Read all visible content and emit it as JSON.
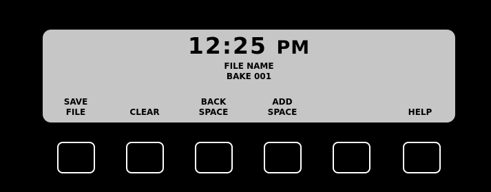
{
  "display": {
    "time": "12:25",
    "ampm": "PM",
    "file_label": "FILE NAME",
    "file_value": "BAKE 001"
  },
  "softkeys": [
    {
      "line1": "SAVE",
      "line2": "FILE"
    },
    {
      "line1": "",
      "line2": "CLEAR"
    },
    {
      "line1": "BACK",
      "line2": "SPACE"
    },
    {
      "line1": "ADD",
      "line2": "SPACE"
    },
    {
      "line1": "",
      "line2": ""
    },
    {
      "line1": "",
      "line2": "HELP"
    }
  ],
  "colors": {
    "background": "#000000",
    "screen": "#c6c6c6",
    "key_border": "#ffffff"
  }
}
